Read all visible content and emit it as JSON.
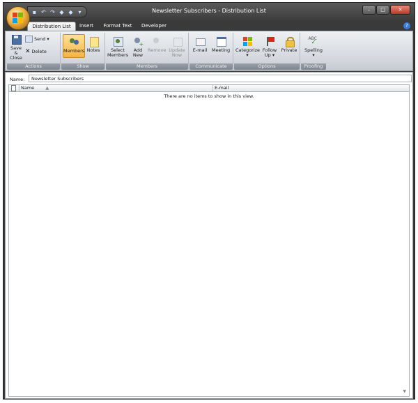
{
  "window": {
    "title": "Newsletter Subscribers - Distribution List"
  },
  "quick_access": {
    "items": [
      "save-icon",
      "undo-icon",
      "redo-icon",
      "previous-icon",
      "next-icon",
      "customize-icon"
    ]
  },
  "tabs": [
    {
      "label": "Distribution List",
      "active": true
    },
    {
      "label": "Insert",
      "active": false
    },
    {
      "label": "Format Text",
      "active": false
    },
    {
      "label": "Developer",
      "active": false
    }
  ],
  "ribbon": {
    "actions": {
      "label": "Actions",
      "save_close": "Save & Close",
      "send": "Send",
      "delete": "Delete"
    },
    "show": {
      "label": "Show",
      "members": "Members",
      "notes": "Notes"
    },
    "members": {
      "label": "Members",
      "select_members": "Select Members",
      "add_new": "Add New",
      "remove": "Remove",
      "update_now": "Update Now"
    },
    "communicate": {
      "label": "Communicate",
      "email": "E-mail",
      "meeting": "Meeting"
    },
    "options": {
      "label": "Options",
      "categorize": "Categorize",
      "follow_up": "Follow Up",
      "private": "Private"
    },
    "proofing": {
      "label": "Proofing",
      "spelling": "Spelling",
      "abc": "ABC"
    }
  },
  "form": {
    "name_label": "Name:",
    "name_value": "Newsletter Subscribers"
  },
  "list": {
    "columns": [
      "Name",
      "E-mail"
    ],
    "empty_message": "There are no items to show in this view."
  },
  "colors": {
    "accent_pressed": "#f4b443",
    "titlebar": "#3a3a3a"
  }
}
